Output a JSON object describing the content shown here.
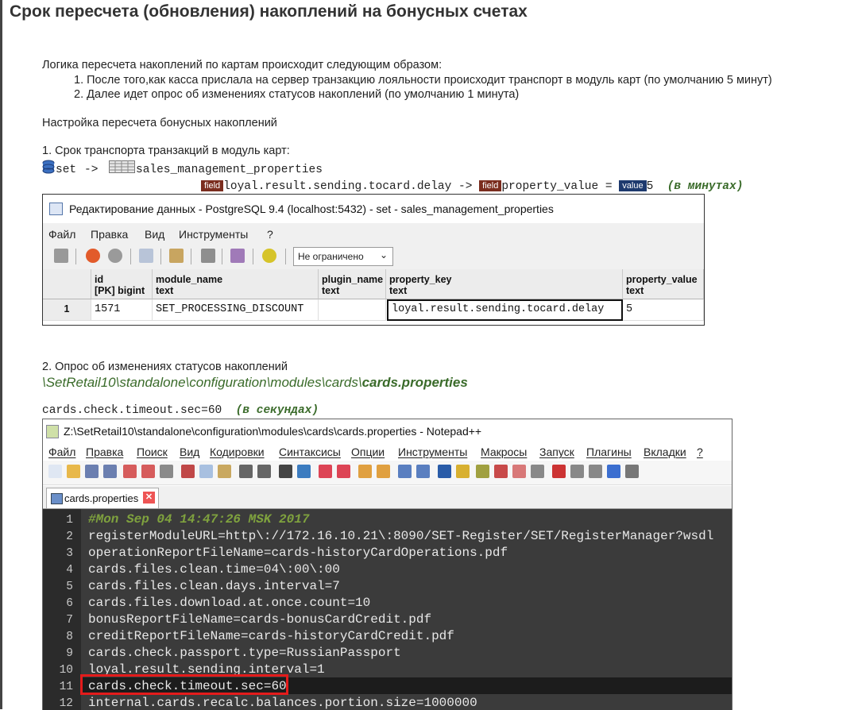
{
  "title": "Срок пересчета (обновления) накоплений на бонусных счетах",
  "intro": "Логика пересчета накоплений по картам происходит следующим образом:",
  "steps": [
    "1. После того,как касса прислала на сервер транзакцию лояльности происходит транспорт в модуль карт (по умолчанию 5 минут)",
    "2. Далее идет опрос об изменениях статусов накоплений (по умолчанию 1 минута)"
  ],
  "setup_heading": "Настройка пересчета бонусных накоплений",
  "section1": {
    "heading": "1. Срок транспорта транзакций в модуль карт:",
    "db": "set",
    "arrow": "->",
    "table": "sales_management_properties",
    "field_badge": "field",
    "value_badge": "value",
    "key_field": "loyal.result.sending.tocard.delay",
    "value_field": "property_value",
    "eq": "=",
    "value": "5",
    "unit": "(в минутах)"
  },
  "pg_window": {
    "title": "Редактирование данных - PostgreSQL 9.4 (localhost:5432) - set - sales_management_properties",
    "menu": [
      "Файл",
      "Правка",
      "Вид",
      "Инструменты",
      "?"
    ],
    "limit_select": "Не ограничено",
    "columns": [
      {
        "name": "id",
        "type": "[PK] bigint"
      },
      {
        "name": "module_name",
        "type": "text"
      },
      {
        "name": "plugin_name",
        "type": "text"
      },
      {
        "name": "property_key",
        "type": "text"
      },
      {
        "name": "property_value",
        "type": "text"
      }
    ],
    "row_num": "1",
    "row": [
      "1571",
      "SET_PROCESSING_DISCOUNT",
      "",
      "loyal.result.sending.tocard.delay",
      "5"
    ]
  },
  "section2": {
    "heading": "2. Опрос об изменениях статусов накоплений",
    "path_prefix": "\\SetRetail10\\standalone\\configuration\\modules\\cards\\",
    "path_file": "cards.properties",
    "setting": "cards.check.timeout.sec=60",
    "unit": "(в секундах)"
  },
  "np_window": {
    "title": "Z:\\SetRetail10\\standalone\\configuration\\modules\\cards\\cards.properties - Notepad++",
    "menu": [
      "Файл",
      "Правка",
      "Поиск",
      "Вид",
      "Кодировки",
      "Синтаксисы",
      "Опции",
      "Инструменты",
      "Макросы",
      "Запуск",
      "Плагины",
      "Вкладки",
      "?"
    ],
    "tab": "cards.properties",
    "lines": [
      {
        "n": "1",
        "text": "#Mon Sep 04 14:47:26 MSK 2017"
      },
      {
        "n": "2",
        "text": "registerModuleURL=http\\://172.16.10.21\\:8090/SET-Register/SET/RegisterManager?wsdl"
      },
      {
        "n": "3",
        "text": "operationReportFileName=cards-historyCardOperations.pdf"
      },
      {
        "n": "4",
        "text": "cards.files.clean.time=04\\:00\\:00"
      },
      {
        "n": "5",
        "text": "cards.files.clean.days.interval=7"
      },
      {
        "n": "6",
        "text": "cards.files.download.at.once.count=10"
      },
      {
        "n": "7",
        "text": "bonusReportFileName=cards-bonusCardCredit.pdf"
      },
      {
        "n": "8",
        "text": "creditReportFileName=cards-historyCardCredit.pdf"
      },
      {
        "n": "9",
        "text": "cards.check.passport.type=RussianPassport"
      },
      {
        "n": "10",
        "text": "loyal.result.sending.interval=1"
      },
      {
        "n": "11",
        "text": "cards.check.timeout.sec=60"
      },
      {
        "n": "12",
        "text": "internal.cards.recalc.balances.portion.size=1000000"
      }
    ]
  },
  "colors": {
    "accent_green": "#3a6b2a",
    "field_badge": "#7b2d1f",
    "value_badge": "#1e3a6e",
    "highlight_red": "#e41b1b",
    "editor_bg": "#3b3b3b"
  }
}
